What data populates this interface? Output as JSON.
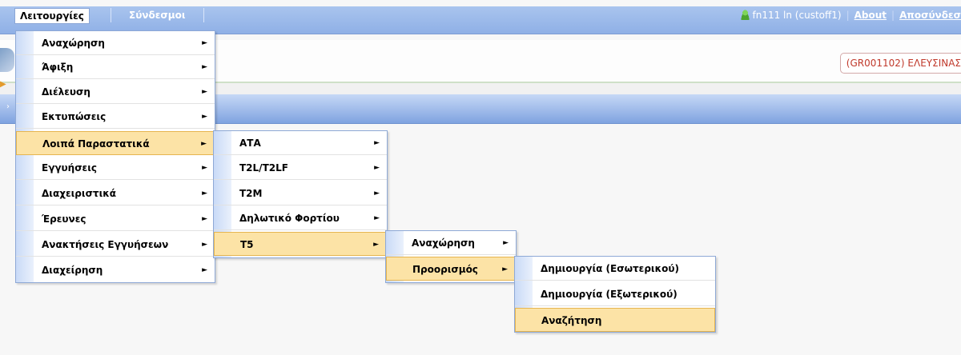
{
  "menubar": {
    "functions": "Λειτουργίες",
    "links": "Σύνδεσμοι",
    "user": "fn111 ln (custoff1)",
    "about": "About",
    "logout": "Αποσύνδεσ"
  },
  "office": "(GR001102) ΕΛΕΥΣΙΝΑΣ",
  "menu1": [
    "Αναχώρηση",
    "Άφιξη",
    "Διέλευση",
    "Εκτυπώσεις",
    "Λοιπά Παραστατικά",
    "Εγγυήσεις",
    "Διαχειριστικά",
    "Έρευνες",
    "Ανακτήσεις Εγγυήσεων",
    "Διαχείρηση"
  ],
  "menu2": [
    "ΑΤΑ",
    "T2L/T2LF",
    "T2M",
    "Δηλωτικό Φορτίου",
    "T5"
  ],
  "menu3": [
    "Αναχώρηση",
    "Προορισμός"
  ],
  "menu4": [
    "Δημιουργία (Εσωτερικού)",
    "Δημιουργία (Εξωτερικού)",
    "Αναζήτηση"
  ],
  "arrow_glyph": "►",
  "colors": {
    "highlight": "#fce3a6",
    "band": "#8fb0e6",
    "office_text": "#c0392b"
  }
}
